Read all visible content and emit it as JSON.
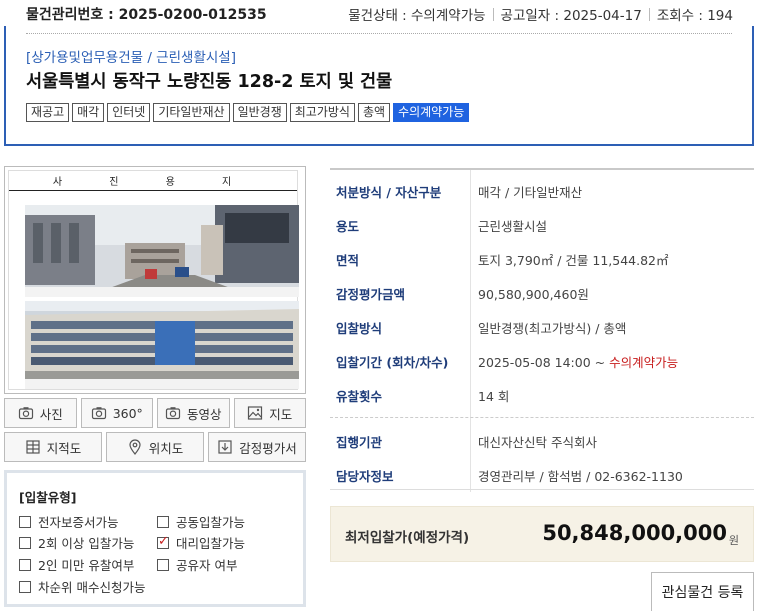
{
  "header": {
    "mgmt_no": "물건관리번호 : 2025-0200-012535",
    "status": "물건상태 : 수의계약가능",
    "notice_date": "공고일자 : 2025-04-17",
    "views": "조회수 : 194"
  },
  "property": {
    "category": "[상가용및업무용건물 / 근린생활시설]",
    "title": "서울특별시 동작구 노량진동 128-2 토지 및 건물",
    "tags": [
      "재공고",
      "매각",
      "인터넷",
      "기타일반재산",
      "일반경쟁",
      "최고가방식",
      "총액",
      "수의계약가능"
    ]
  },
  "photo": {
    "sheet_title": "사 진 용 지"
  },
  "media_buttons": {
    "photo": "사진",
    "view360": "360°",
    "video": "동영상",
    "map": "지도",
    "cadastral": "지적도",
    "location": "위치도",
    "appraisal": "감정평가서"
  },
  "bid_type": {
    "title": "[입찰유형]",
    "options": [
      {
        "label": "전자보증서가능",
        "checked": false
      },
      {
        "label": "공동입찰가능",
        "checked": false
      },
      {
        "label": "2회 이상 입찰가능",
        "checked": false
      },
      {
        "label": "대리입찰가능",
        "checked": true
      },
      {
        "label": "2인 미만 유찰여부",
        "checked": false
      },
      {
        "label": "공유자 여부",
        "checked": false
      },
      {
        "label": "차순위 매수신청가능",
        "checked": false
      }
    ]
  },
  "details": {
    "disposal_label": "처분방식 / 자산구분",
    "disposal_value": "매각 / 기타일반재산",
    "usage_label": "용도",
    "usage_value": "근린생활시설",
    "area_label": "면적",
    "area_value": "토지 3,790㎡ / 건물 11,544.82㎡",
    "appraisal_label": "감정평가금액",
    "appraisal_value": "90,580,900,460원",
    "bid_method_label": "입찰방식",
    "bid_method_value": "일반경쟁(최고가방식) / 총액",
    "bid_period_label": "입찰기간 (회차/차수)",
    "bid_period_value": "2025-05-08 14:00 ~ ",
    "bid_period_status": "수의계약가능",
    "fail_count_label": "유찰횟수",
    "fail_count_value": "14 회",
    "agency_label": "집행기관",
    "agency_value": "대신자산신탁 주식회사",
    "contact_label": "담당자정보",
    "contact_value": "경영관리부 / 함석범 / 02-6362-1130"
  },
  "price": {
    "label": "최저입찰가(예정가격)",
    "value": "50,848,000,000",
    "unit": "원"
  },
  "favorite_button": "관심물건 등록",
  "colors": {
    "accent": "#2d5fb5",
    "active_tag": "#1f63e0",
    "label": "#1f3d7a",
    "red": "#c81e1e"
  }
}
